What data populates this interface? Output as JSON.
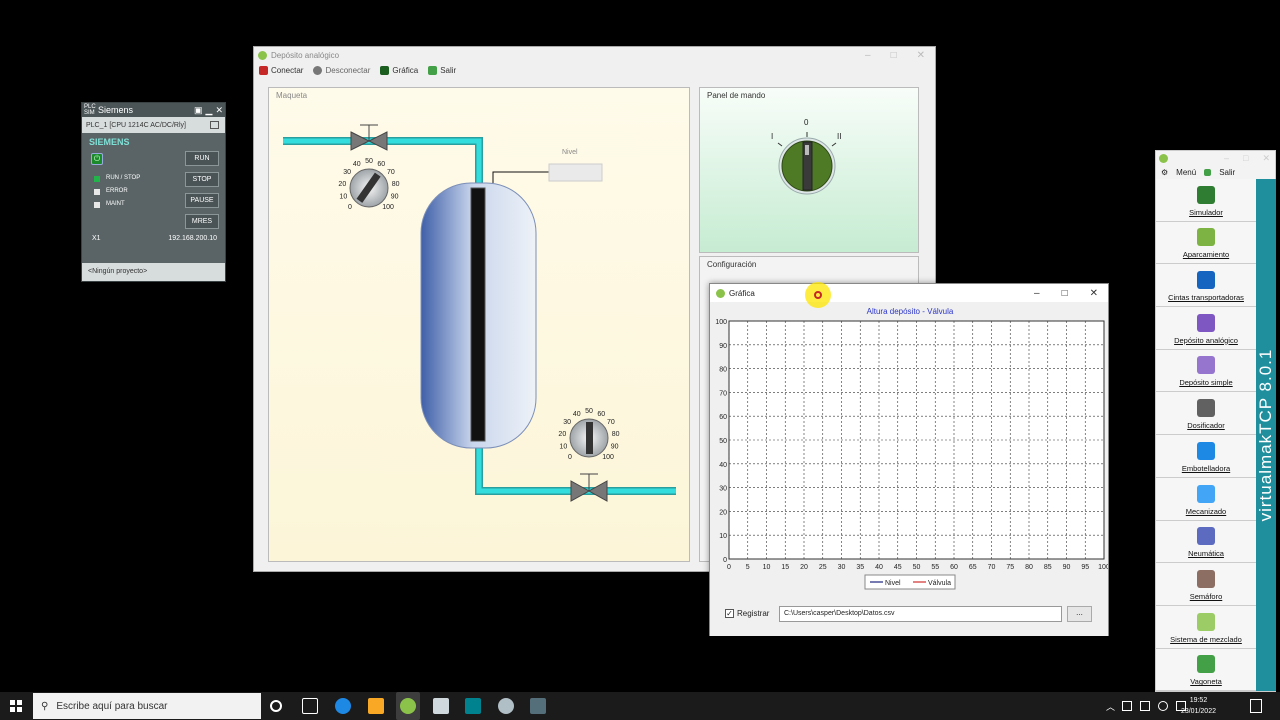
{
  "plcsim": {
    "logo": "PLC SIM",
    "title": "Siemens",
    "cpu": "PLC_1 [CPU 1214C AC/DC/Rly]",
    "brand": "SIEMENS",
    "leds": [
      "RUN / STOP",
      "ERROR",
      "MAINT"
    ],
    "buttons": [
      "RUN",
      "STOP",
      "PAUSE",
      "MRES"
    ],
    "port": "X1",
    "ip": "192.168.200.10",
    "project": "<Ningún proyecto>"
  },
  "deposito": {
    "title": "Depósito analógico",
    "menu": [
      "Conectar",
      "Desconectar",
      "Gráfica",
      "Salir"
    ],
    "maqueta_label": "Maqueta",
    "nivel_label": "Nivel",
    "dial_ticks": [
      "0",
      "10",
      "20",
      "30",
      "40",
      "50",
      "60",
      "70",
      "80",
      "90",
      "100"
    ],
    "panel_label": "Panel de mando",
    "switch_labels": [
      "I",
      "0",
      "II"
    ],
    "config_label": "Configuración",
    "colors": {
      "pipe": "#33cccc",
      "tank": "#4a6fb5",
      "switch": "#4f7a25"
    }
  },
  "grafica": {
    "title": "Gráfica",
    "chart_data": {
      "type": "line",
      "title": "Altura depósito - Válvula",
      "x_ticks": [
        "0",
        "5",
        "10",
        "15",
        "20",
        "25",
        "30",
        "35",
        "40",
        "45",
        "50",
        "55",
        "60",
        "65",
        "70",
        "75",
        "80",
        "85",
        "90",
        "95",
        "100"
      ],
      "y_ticks": [
        "0",
        "10",
        "20",
        "30",
        "40",
        "50",
        "60",
        "70",
        "80",
        "90",
        "100"
      ],
      "xlim": [
        0,
        100
      ],
      "ylim": [
        0,
        100
      ],
      "grid": true,
      "series": [
        {
          "name": "Nivel",
          "color": "#1a237e",
          "values": []
        },
        {
          "name": "Válvula",
          "color": "#d32f2f",
          "values": []
        }
      ],
      "legend": "bottom"
    },
    "registrar_label": "Registrar",
    "registrar_checked": "✓",
    "path": "C:\\Users\\casper\\Desktop\\Datos.csv",
    "browse_label": "..."
  },
  "launcher": {
    "menu": [
      "Menú",
      "Salir"
    ],
    "items": [
      {
        "label": "Simulador",
        "color": "#2e7d32"
      },
      {
        "label": "Aparcamiento",
        "color": "#7cb342"
      },
      {
        "label": "Cintas transportadoras",
        "color": "#1565c0"
      },
      {
        "label": "Depósito analógico",
        "color": "#7e57c2"
      },
      {
        "label": "Depósito simple",
        "color": "#9575cd"
      },
      {
        "label": "Dosificador",
        "color": "#616161"
      },
      {
        "label": "Embotelladora",
        "color": "#1e88e5"
      },
      {
        "label": "Mecanizado",
        "color": "#42a5f5"
      },
      {
        "label": "Neumática",
        "color": "#5c6bc0"
      },
      {
        "label": "Semáforo",
        "color": "#8d6e63"
      },
      {
        "label": "Sistema de mezclado",
        "color": "#9ccc65"
      },
      {
        "label": "Vagoneta",
        "color": "#43a047"
      }
    ],
    "brand": "virtualmakTCP 8.0.1"
  },
  "taskbar": {
    "search_placeholder": "Escribe aquí para buscar",
    "time": "19:52",
    "date": "23/01/2022"
  }
}
